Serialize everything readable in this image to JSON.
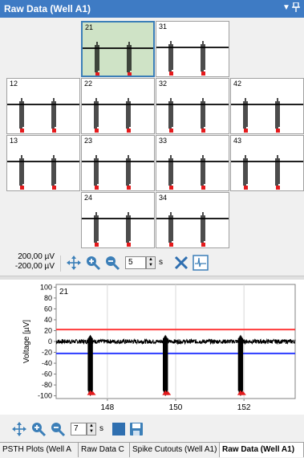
{
  "window": {
    "title": "Raw Data (Well A1)",
    "pin_icon": "pin-icon",
    "dropdown_icon": "chevron-down-icon"
  },
  "electrodes": [
    {
      "id": "21",
      "selected": true
    },
    {
      "id": "31",
      "selected": false
    },
    {
      "id": "12",
      "selected": false
    },
    {
      "id": "22",
      "selected": false
    },
    {
      "id": "32",
      "selected": false
    },
    {
      "id": "42",
      "selected": false
    },
    {
      "id": "13",
      "selected": false
    },
    {
      "id": "23",
      "selected": false
    },
    {
      "id": "33",
      "selected": false
    },
    {
      "id": "43",
      "selected": false
    },
    {
      "id": "24",
      "selected": false
    },
    {
      "id": "34",
      "selected": false
    }
  ],
  "grid_toolbar": {
    "range_max": "200,00 µV",
    "range_min": "-200,00 µV",
    "window_value": "5",
    "window_unit": "s",
    "icons": [
      "autoscale-icon",
      "zoom-in-icon",
      "zoom-out-icon",
      "close-icon",
      "threshold-icon"
    ]
  },
  "detail_plot": {
    "electrode": "21",
    "y_label": "Voltage [µV]"
  },
  "chart_data": {
    "type": "line",
    "title": "",
    "xlabel": "",
    "ylabel": "Voltage [µV]",
    "xlim": [
      146.5,
      153.5
    ],
    "ylim": [
      -105,
      105
    ],
    "x_ticks": [
      "148",
      "150",
      "152"
    ],
    "x_tick_values": [
      148,
      150,
      152
    ],
    "y_ticks": [
      "100",
      "80",
      "60",
      "40",
      "20",
      "0",
      "-20",
      "-40",
      "-60",
      "-80",
      "-100"
    ],
    "y_tick_values": [
      100,
      80,
      60,
      40,
      20,
      0,
      -20,
      -40,
      -60,
      -80,
      -100
    ],
    "thresholds": [
      {
        "name": "upper",
        "value": 22,
        "color": "#ff3b3b"
      },
      {
        "name": "lower",
        "value": -22,
        "color": "#2b3bff"
      }
    ],
    "spike_times": [
      147.5,
      149.7,
      151.9
    ],
    "spike_min": -100,
    "spike_max": 12,
    "noise_amplitude": 4,
    "trace_color": "#000000",
    "marker_color": "#e41a1c"
  },
  "detail_toolbar": {
    "window_value": "7",
    "window_unit": "s",
    "icons": [
      "autoscale-icon",
      "zoom-in-icon",
      "zoom-out-icon",
      "color-icon",
      "save-icon"
    ]
  },
  "tabs": [
    {
      "label": "PSTH Plots (Well A",
      "active": false
    },
    {
      "label": "Raw Data C",
      "active": false
    },
    {
      "label": "Spike Cutouts (Well A1)",
      "active": false
    },
    {
      "label": "Raw Data (Well A1)",
      "active": true
    }
  ]
}
